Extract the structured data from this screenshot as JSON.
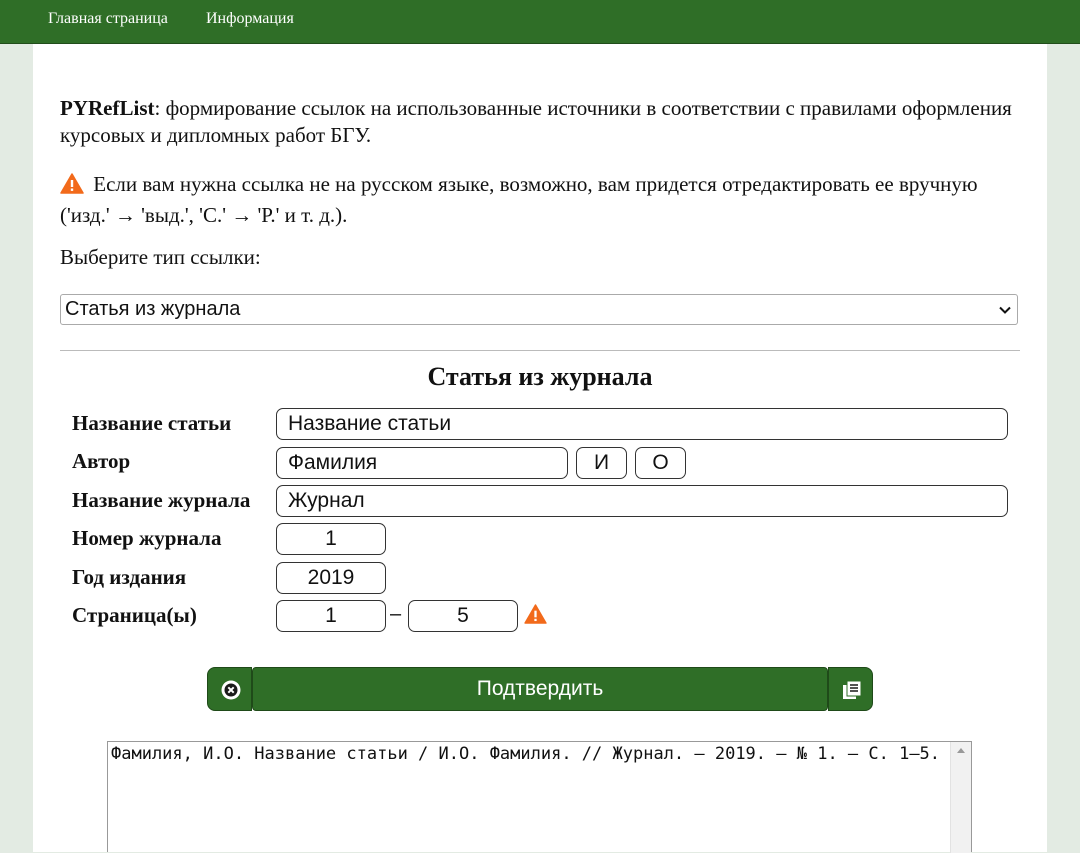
{
  "nav": {
    "home": "Главная страница",
    "info": "Информация"
  },
  "intro": {
    "brand": "PYRefList",
    "text": ": формирование ссылок на использованные источники в соответствии с правилами оформления курсовых и дипломных работ БГУ."
  },
  "warning": {
    "text": " Если вам нужна ссылка не на русском языке, возможно, вам придется отредактировать ее вручную ('изд.' → 'выд.', 'С.' → 'Р.' и т. д.)."
  },
  "type_select": {
    "label": "Выберите тип ссылки:",
    "selected": "Статья из журнала"
  },
  "form": {
    "title": "Статья из журнала",
    "article_title": {
      "label": "Название статьи",
      "value": "Название статьи"
    },
    "author": {
      "label": "Автор",
      "surname": "Фамилия",
      "initial1": "И",
      "initial2": "О"
    },
    "journal": {
      "label": "Название журнала",
      "value": "Журнал"
    },
    "issue": {
      "label": "Номер журнала",
      "value": "1"
    },
    "year": {
      "label": "Год издания",
      "value": "2019"
    },
    "pages": {
      "label": "Страница(ы)",
      "from": "1",
      "separator": "–",
      "to": "5"
    }
  },
  "actions": {
    "submit": "Подтвердить"
  },
  "output": {
    "text": "Фамилия, И.О. Название статьи / И.О. Фамилия. // Журнал. – 2019. – № 1. – С. 1–5."
  },
  "colors": {
    "nav_bg": "#2f6e27",
    "button_bg": "#2f6e27",
    "page_bg": "#e3ebe3",
    "warning": "#f26a1b"
  },
  "icons": {
    "warning": "warning-triangle-icon",
    "clear": "close-circle-icon",
    "copy": "copy-icon",
    "dropdown": "chevron-down-icon"
  }
}
